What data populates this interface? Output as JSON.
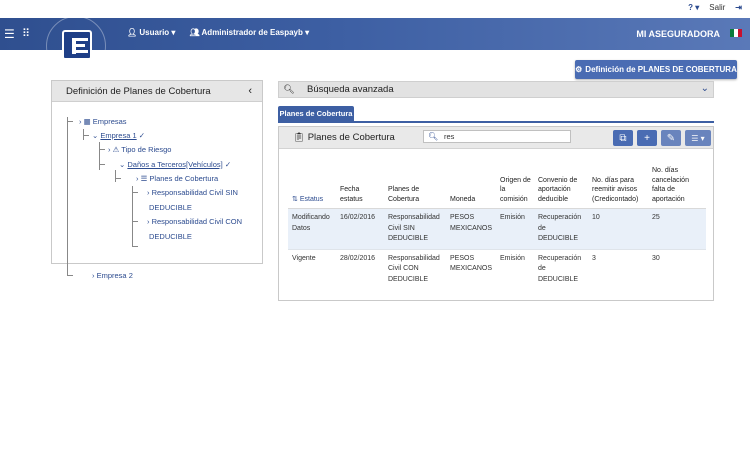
{
  "topbar": {
    "help_icon": "help-icon",
    "salir_label": "Salir"
  },
  "header": {
    "user_menu": "Usuario",
    "admin_menu": "Administrador de Easpayb",
    "insurer": "MI ASEGURADORA"
  },
  "definition_button": "Definición de PLANES DE COBERTURA",
  "left_panel": {
    "title": "Definición de Planes de Cobertura",
    "tree": {
      "root": "Empresas",
      "company1": "Empresa 1",
      "risk_type": "Tipo de Riesgo",
      "damages": "Daños a Terceros[Vehículos]",
      "plans": "Planes de Cobertura",
      "plan_without_line1": "Responsabilidad Civil SIN",
      "plan_without_line2": "DEDUCIBLE",
      "plan_with_line1": "Responsabilidad Civil CON",
      "plan_with_line2": "DEDUCIBLE",
      "company2": "Empresa 2"
    }
  },
  "advanced_search": "Búsqueda avanzada",
  "tab_label": "Planes de Cobertura",
  "card": {
    "title": "Planes de Cobertura",
    "search_value": "res"
  },
  "table": {
    "headers": {
      "estatus": "Estatus",
      "fecha": "Fecha estatus",
      "planes": "Planes de Cobertura",
      "moneda": "Moneda",
      "origen": "Origen de la comisión",
      "convenio": "Convenio de aportación deducible",
      "dias_reemitir": "No. días para reemitir avisos (Credicontado)",
      "dias_cancelacion": "No. días cancelación falta de aportación"
    },
    "rows": [
      {
        "estatus": "Modificando Datos",
        "fecha": "16/02/2016",
        "plan": "Responsabilidad Civil SIN DEDUCIBLE",
        "moneda": "PESOS MEXICANOS",
        "origen": "Emisión",
        "convenio": "Recuperación de DEDUCIBLE",
        "dias_reemitir": "10",
        "dias_cancelacion": "25"
      },
      {
        "estatus": "Vigente",
        "fecha": "28/02/2016",
        "plan": "Responsabilidad Civil CON DEDUCIBLE",
        "moneda": "PESOS MEXICANOS",
        "origen": "Emisión",
        "convenio": "Recuperación de DEDUCIBLE",
        "dias_reemitir": "3",
        "dias_cancelacion": "30"
      }
    ]
  },
  "colors": {
    "header_blue": "#3d5fa3",
    "button_blue": "#4a6cb3",
    "link_blue": "#2c4b8f",
    "row_highlight": "#e9f0f9"
  }
}
